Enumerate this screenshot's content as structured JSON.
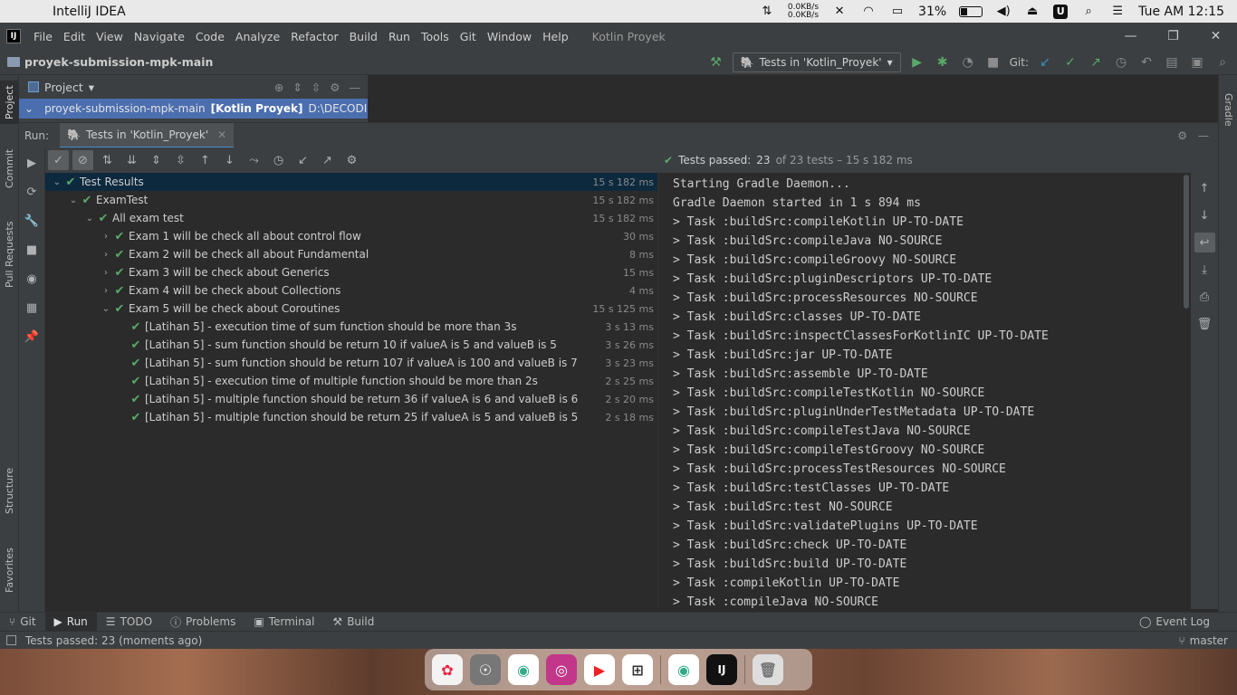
{
  "mac_menubar": {
    "app_name": "IntelliJ IDEA",
    "net_up": "0.0KB/s",
    "net_down": "0.0KB/s",
    "battery": "31%",
    "clock": "Tue AM 12:15"
  },
  "ide_menu": {
    "items": [
      "File",
      "Edit",
      "View",
      "Navigate",
      "Code",
      "Analyze",
      "Refactor",
      "Build",
      "Run",
      "Tools",
      "Git",
      "Window",
      "Help"
    ],
    "title": "Kotlin Proyek"
  },
  "navbar": {
    "breadcrumb": "proyek-submission-mpk-main",
    "run_config": "Tests in 'Kotlin_Proyek'",
    "git_label": "Git:"
  },
  "left_stripe": {
    "tabs": [
      "Project",
      "Commit",
      "Pull Requests",
      "Structure",
      "Favorites"
    ]
  },
  "right_stripe": {
    "tabs": [
      "Gradle"
    ]
  },
  "project_panel": {
    "title": "Project",
    "root_name": "proyek-submission-mpk-main",
    "root_module": "[Kotlin Proyek]",
    "root_path": "D:\\DECODING BE"
  },
  "run_panel": {
    "label": "Run:",
    "tab_title": "Tests in 'Kotlin_Proyek'",
    "status_prefix": "Tests passed:",
    "status_count": "23",
    "status_suffix": "of 23 tests – 15 s 182 ms"
  },
  "test_tree": [
    {
      "label": "Test Results",
      "time": "15 s 182 ms",
      "level": 0,
      "expanded": true
    },
    {
      "label": "ExamTest",
      "time": "15 s 182 ms",
      "level": 1,
      "expanded": true
    },
    {
      "label": "All exam test",
      "time": "15 s 182 ms",
      "level": 2,
      "expanded": true
    },
    {
      "label": "Exam 1 will be check all about control flow",
      "time": "30 ms",
      "level": 3,
      "expanded": false
    },
    {
      "label": "Exam 2 will be check all about Fundamental",
      "time": "8 ms",
      "level": 3,
      "expanded": false
    },
    {
      "label": "Exam 3 will be check about Generics",
      "time": "15 ms",
      "level": 3,
      "expanded": false
    },
    {
      "label": "Exam 4 will be check about Collections",
      "time": "4 ms",
      "level": 3,
      "expanded": false
    },
    {
      "label": "Exam 5 will be check about Coroutines",
      "time": "15 s 125 ms",
      "level": 3,
      "expanded": true
    },
    {
      "label": "[Latihan 5] - execution time of sum function should be more than 3s",
      "time": "3 s 13 ms",
      "level": 4,
      "leaf": true
    },
    {
      "label": "[Latihan 5] - sum function should be return 10 if valueA is 5 and valueB is 5",
      "time": "3 s 26 ms",
      "level": 4,
      "leaf": true
    },
    {
      "label": "[Latihan 5] - sum function should be return 107 if valueA is 100 and valueB is 7",
      "time": "3 s 23 ms",
      "level": 4,
      "leaf": true
    },
    {
      "label": "[Latihan 5] - execution time of multiple function should be more than 2s",
      "time": "2 s 25 ms",
      "level": 4,
      "leaf": true
    },
    {
      "label": "[Latihan 5] - multiple function should be return 36 if valueA is 6 and valueB is 6",
      "time": "2 s 20 ms",
      "level": 4,
      "leaf": true
    },
    {
      "label": "[Latihan 5] - multiple function should be return 25 if valueA is 5 and valueB is 5",
      "time": "2 s 18 ms",
      "level": 4,
      "leaf": true
    }
  ],
  "console_lines": [
    "Starting Gradle Daemon...",
    "Gradle Daemon started in 1 s 894 ms",
    "> Task :buildSrc:compileKotlin UP-TO-DATE",
    "> Task :buildSrc:compileJava NO-SOURCE",
    "> Task :buildSrc:compileGroovy NO-SOURCE",
    "> Task :buildSrc:pluginDescriptors UP-TO-DATE",
    "> Task :buildSrc:processResources NO-SOURCE",
    "> Task :buildSrc:classes UP-TO-DATE",
    "> Task :buildSrc:inspectClassesForKotlinIC UP-TO-DATE",
    "> Task :buildSrc:jar UP-TO-DATE",
    "> Task :buildSrc:assemble UP-TO-DATE",
    "> Task :buildSrc:compileTestKotlin NO-SOURCE",
    "> Task :buildSrc:pluginUnderTestMetadata UP-TO-DATE",
    "> Task :buildSrc:compileTestJava NO-SOURCE",
    "> Task :buildSrc:compileTestGroovy NO-SOURCE",
    "> Task :buildSrc:processTestResources NO-SOURCE",
    "> Task :buildSrc:testClasses UP-TO-DATE",
    "> Task :buildSrc:test NO-SOURCE",
    "> Task :buildSrc:validatePlugins UP-TO-DATE",
    "> Task :buildSrc:check UP-TO-DATE",
    "> Task :buildSrc:build UP-TO-DATE",
    "> Task :compileKotlin UP-TO-DATE",
    "> Task :compileJava NO-SOURCE"
  ],
  "bottom_tools": {
    "git": "Git",
    "run": "Run",
    "todo": "TODO",
    "problems": "Problems",
    "terminal": "Terminal",
    "build": "Build",
    "event_log": "Event Log"
  },
  "status_bar": {
    "message": "Tests passed: 23 (moments ago)",
    "branch": "master"
  },
  "colors": {
    "pass_green": "#59a869",
    "selection_blue": "#4b6eaf",
    "background": "#2b2b2b",
    "panel": "#3c3f41"
  }
}
